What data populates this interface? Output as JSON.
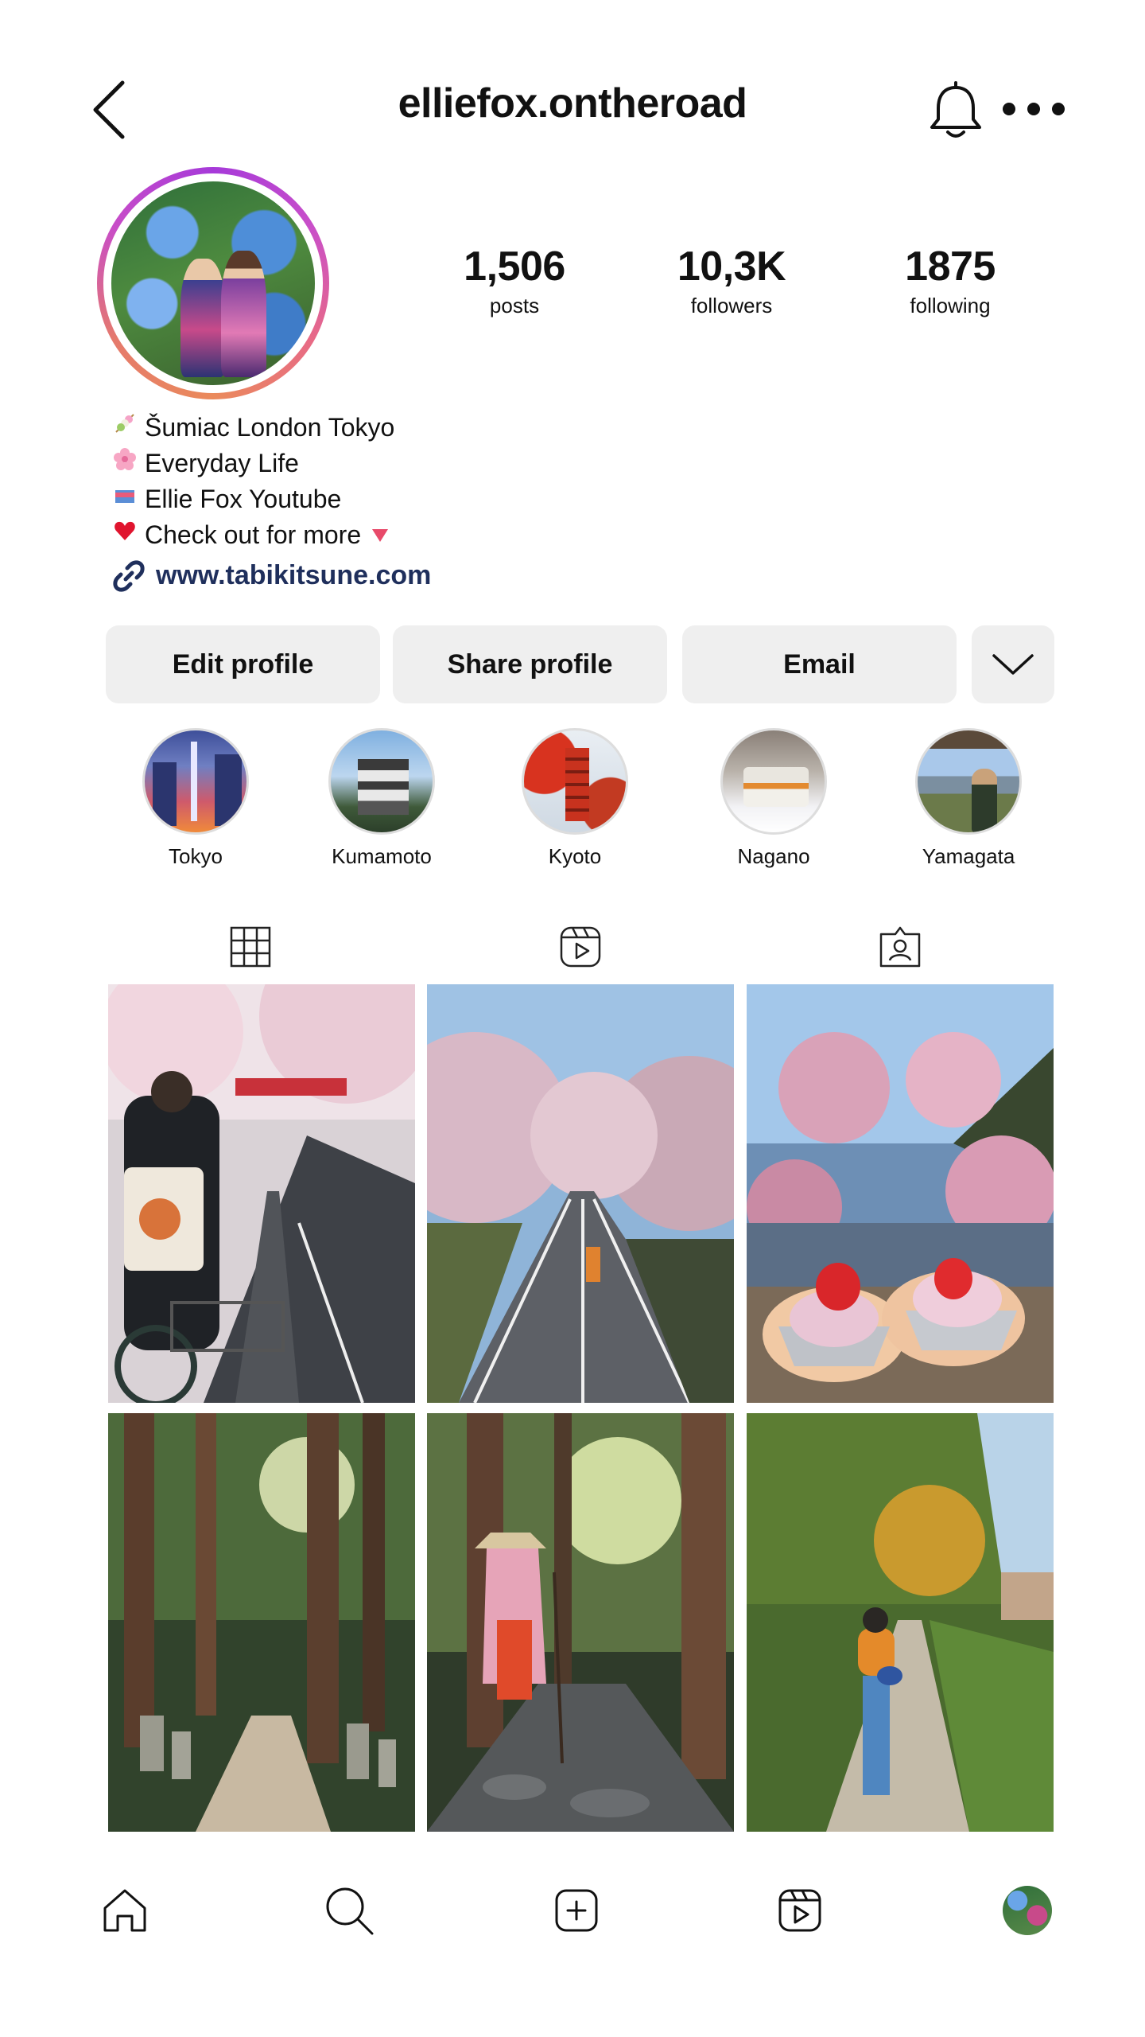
{
  "header": {
    "username": "elliefox.ontheroad"
  },
  "stats": [
    {
      "value": "1,506",
      "label": "posts"
    },
    {
      "value": "10,3K",
      "label": "followers"
    },
    {
      "value": "1875",
      "label": "following"
    }
  ],
  "bio": {
    "lines": [
      {
        "icon": "dango-icon",
        "text": "Šumiac London Tokyo"
      },
      {
        "icon": "cherry-blossom-icon",
        "text": "Everyday Life"
      },
      {
        "icon": "flag-icon",
        "text": "Ellie Fox Youtube"
      },
      {
        "icon": "red-heart-icon",
        "text": "Check out for more"
      }
    ],
    "link": "www.tabikitsune.com"
  },
  "buttons": {
    "edit": "Edit profile",
    "share": "Share profile",
    "email": "Email"
  },
  "highlights": [
    {
      "label": "Tokyo"
    },
    {
      "label": "Kumamoto"
    },
    {
      "label": "Kyoto"
    },
    {
      "label": "Nagano"
    },
    {
      "label": "Yamagata"
    }
  ],
  "tabs": [
    "grid-icon",
    "reels-icon",
    "tagged-icon"
  ],
  "grid": [
    {
      "subject": "cherry blossom street with bicycle"
    },
    {
      "subject": "cherry blossom road"
    },
    {
      "subject": "strawberry daifuku under blossoms"
    },
    {
      "subject": "cedar forest cemetery path"
    },
    {
      "subject": "pilgrim in forest"
    },
    {
      "subject": "autumn country path"
    }
  ],
  "colors": {
    "button_bg": "#efefef",
    "link": "#1f2f5c",
    "ring_start": "#a63ad9",
    "ring_end": "#ea8a5b"
  }
}
